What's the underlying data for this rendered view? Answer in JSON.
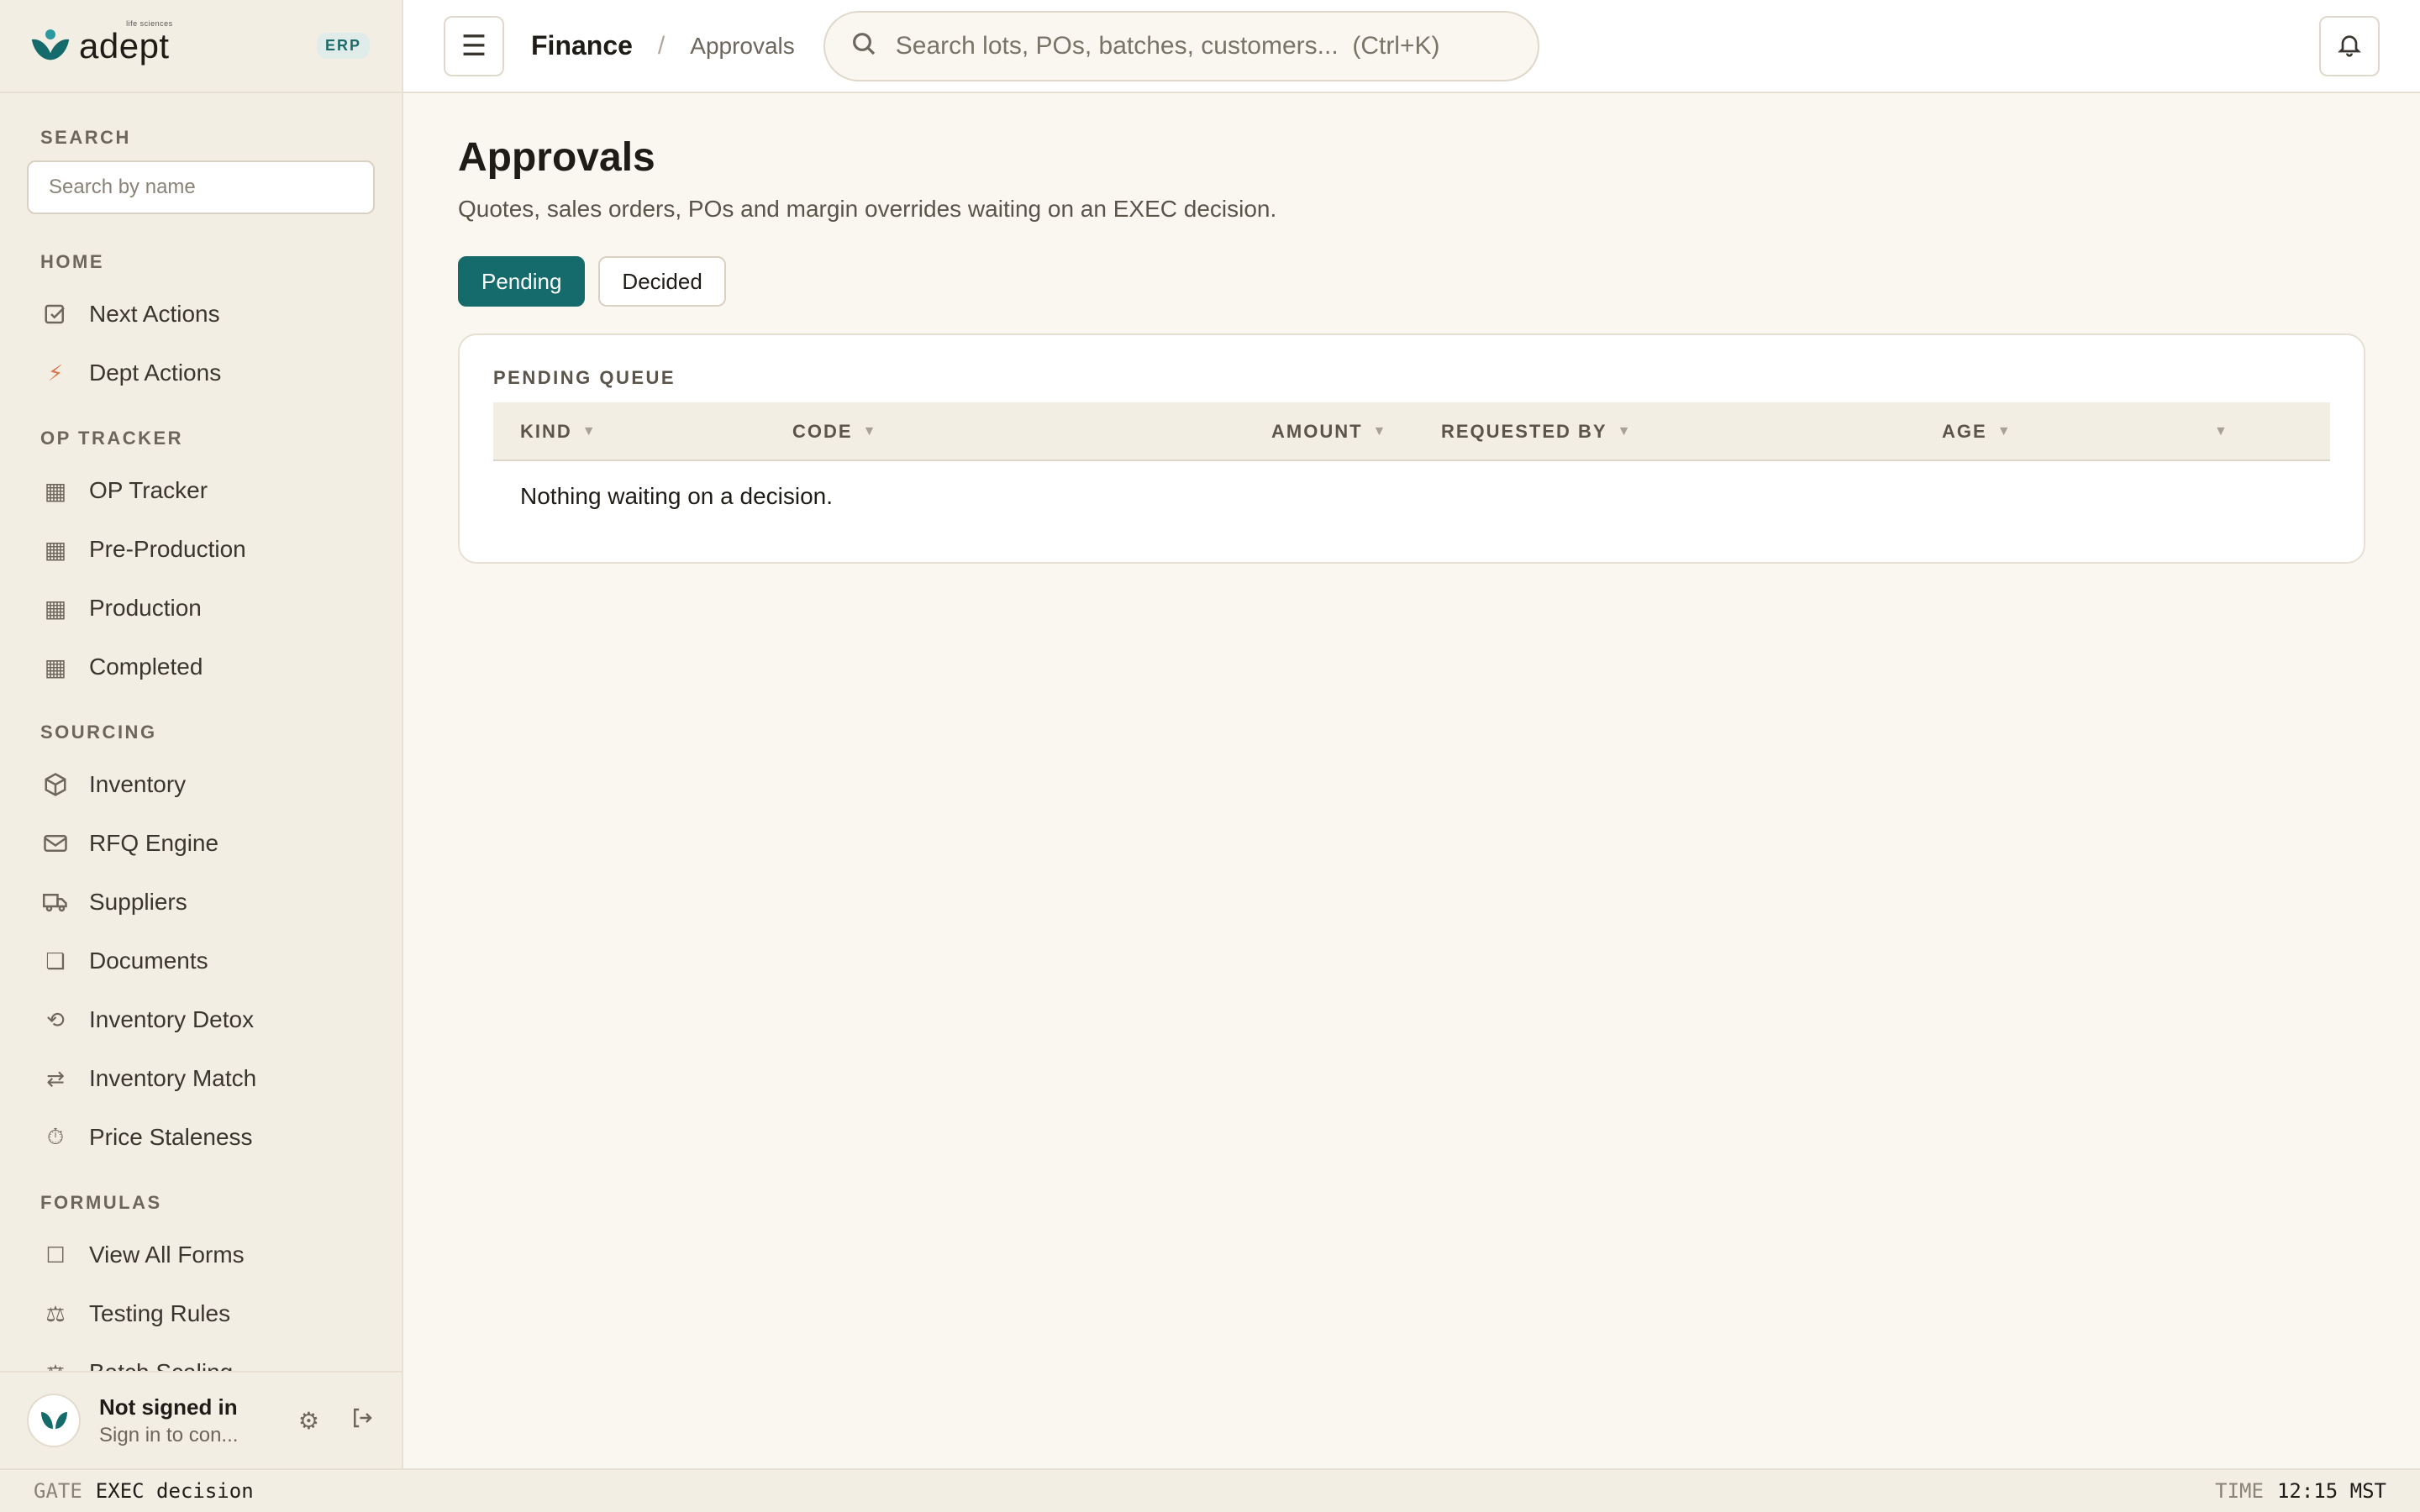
{
  "brand": {
    "name": "adept",
    "tagline": "life sciences",
    "badge": "ERP"
  },
  "sidebar": {
    "search_label": "SEARCH",
    "search_placeholder": "Search by name",
    "groups": [
      {
        "label": "HOME",
        "items": [
          {
            "label": "Next Actions",
            "icon": "check-square-icon"
          },
          {
            "label": "Dept Actions",
            "icon": "bolt-icon"
          }
        ]
      },
      {
        "label": "OP TRACKER",
        "items": [
          {
            "label": "OP Tracker",
            "icon": "grid-icon"
          },
          {
            "label": "Pre-Production",
            "icon": "grid-icon"
          },
          {
            "label": "Production",
            "icon": "grid-icon"
          },
          {
            "label": "Completed",
            "icon": "grid-icon"
          }
        ]
      },
      {
        "label": "SOURCING",
        "items": [
          {
            "label": "Inventory",
            "icon": "box-icon"
          },
          {
            "label": "RFQ Engine",
            "icon": "mail-icon"
          },
          {
            "label": "Suppliers",
            "icon": "truck-icon"
          },
          {
            "label": "Documents",
            "icon": "document-icon"
          },
          {
            "label": "Inventory Detox",
            "icon": "refresh-icon"
          },
          {
            "label": "Inventory Match",
            "icon": "swap-icon"
          },
          {
            "label": "Price Staleness",
            "icon": "timer-icon"
          }
        ]
      },
      {
        "label": "FORMULAS",
        "items": [
          {
            "label": "View All Forms",
            "icon": "square-icon"
          },
          {
            "label": "Testing Rules",
            "icon": "scale-icon"
          },
          {
            "label": "Batch Scaling",
            "icon": "scale-icon"
          }
        ]
      }
    ]
  },
  "user": {
    "name": "Not signed in",
    "subtitle": "Sign in to con..."
  },
  "topbar": {
    "breadcrumb_root": "Finance",
    "breadcrumb_sep": "/",
    "breadcrumb_leaf": "Approvals",
    "search_placeholder": "Search lots, POs, batches, customers...  (Ctrl+K)"
  },
  "main": {
    "title": "Approvals",
    "subtitle": "Quotes, sales orders, POs and margin overrides waiting on an EXEC decision.",
    "tabs": [
      {
        "label": "Pending",
        "active": true
      },
      {
        "label": "Decided",
        "active": false
      }
    ],
    "card_label": "PENDING QUEUE",
    "columns": [
      "KIND",
      "CODE",
      "AMOUNT",
      "REQUESTED BY",
      "AGE",
      ""
    ],
    "empty_message": "Nothing waiting on a decision."
  },
  "statusbar": {
    "gate_key": "GATE",
    "gate_value": "EXEC decision",
    "time_key": "TIME",
    "time_value": "12:15 MST"
  },
  "colors": {
    "accent": "#156b6b",
    "bolt": "#e2734a",
    "background": "#faf7f0",
    "sidebar": "#f3eee3"
  }
}
